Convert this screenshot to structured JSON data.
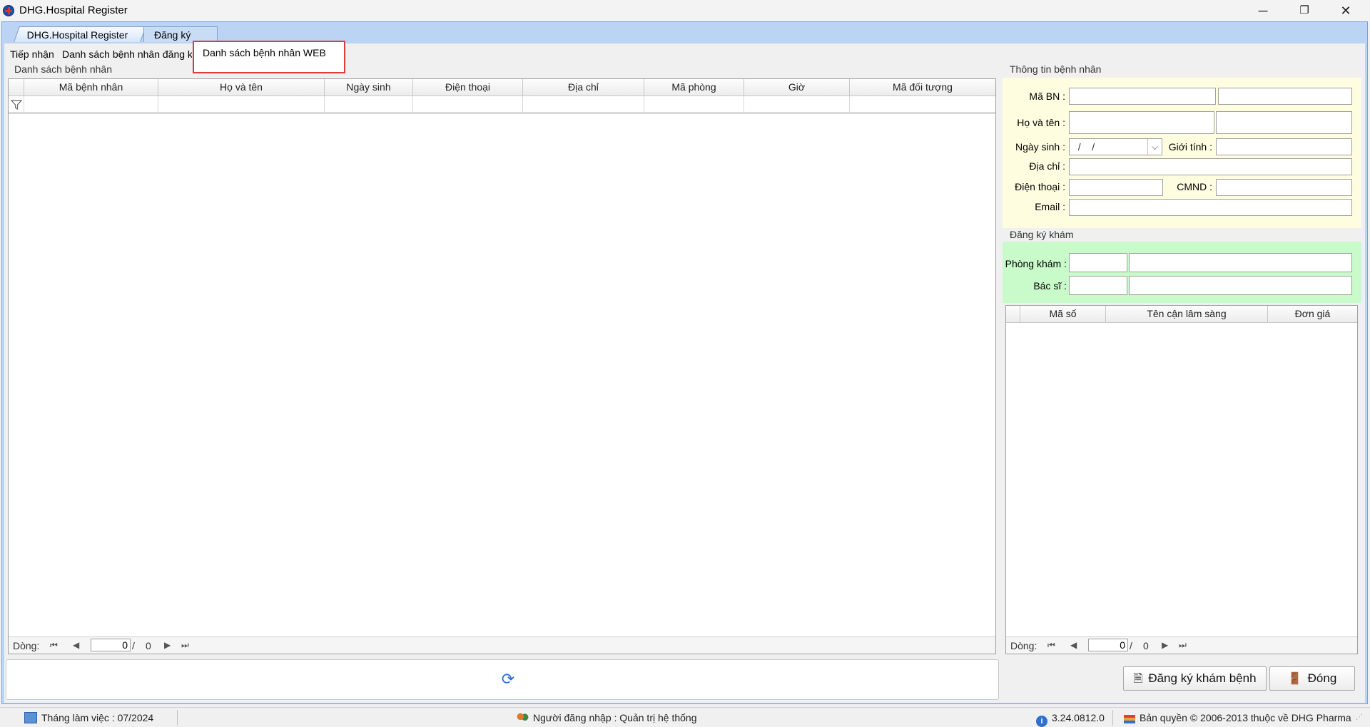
{
  "window": {
    "title": "DHG.Hospital Register",
    "minimize": "─",
    "maximize": "❐",
    "close": "✕"
  },
  "doc_tabs": [
    "DHG.Hospital Register",
    "Đăng ký KCB"
  ],
  "sub_tabs": [
    "Tiếp nhận",
    "Danh sách bệnh nhân đăng ký",
    "Danh sách bệnh nhân WEB"
  ],
  "left_group": {
    "title": "Danh sách bệnh nhân",
    "columns": [
      "Mã bệnh nhân",
      "Họ và tên",
      "Ngày sinh",
      "Điện thoại",
      "Địa chỉ",
      "Mã phòng",
      "Giờ",
      "Mã đối tượng"
    ],
    "footer": {
      "label": "Dòng:",
      "current": "0",
      "separator": "/",
      "total": "0"
    }
  },
  "patient_info": {
    "title": "Thông tin bệnh nhân",
    "ma_bn_label": "Mã BN :",
    "ho_ten_label": "Họ và tên :",
    "ngay_sinh_label": "Ngày sinh :",
    "ngay_sinh_value": "  /    /",
    "gioi_tinh_label": "Giới tính :",
    "dia_chi_label": "Địa chỉ :",
    "dien_thoai_label": "Điện thoại :",
    "cmnd_label": "CMND :",
    "email_label": "Email :"
  },
  "registration": {
    "title": "Đăng ký khám",
    "phong_kham_label": "Phòng khám :",
    "bac_si_label": "Bác sĩ :",
    "columns": [
      "Mã số",
      "Tên cận lâm sàng",
      "Đơn giá"
    ],
    "footer": {
      "label": "Dòng:",
      "current": "0",
      "separator": "/",
      "total": "0"
    }
  },
  "buttons": {
    "register": "Đăng ký khám bệnh",
    "close": "Đóng"
  },
  "status_bar": {
    "month": "Tháng làm việc : 07/2024",
    "user": "Người đăng nhập : Quản trị hệ thống",
    "version": "3.24.0812.0",
    "copyright": "Bản quyền © 2006-2013 thuộc về DHG Pharma"
  },
  "colors": {
    "frame_blue": "#bcd4f4",
    "patient_info_bg": "#fffde0",
    "registration_bg": "#c9fac9",
    "highlight_red": "#e03c3c"
  }
}
